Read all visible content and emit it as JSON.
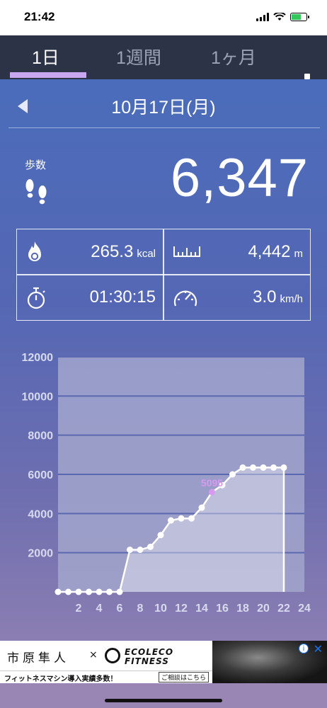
{
  "status_bar": {
    "time": "21:42"
  },
  "tabs": [
    {
      "label": "1日",
      "active": true
    },
    {
      "label": "1週間",
      "active": false
    },
    {
      "label": "1ヶ月",
      "active": false
    }
  ],
  "menu_icon": "kebab-menu-icon",
  "date": {
    "label": "10月17日(月)"
  },
  "steps": {
    "label": "歩数",
    "value": "6,347"
  },
  "stats": {
    "calories": {
      "value": "265.3",
      "unit": "kcal",
      "icon": "flame-icon"
    },
    "distance": {
      "value": "4,442",
      "unit": "m",
      "icon": "ruler-icon"
    },
    "duration": {
      "value": "01:30:15",
      "icon": "stopwatch-icon"
    },
    "speed": {
      "value": "3.0",
      "unit": "km/h",
      "icon": "speedometer-icon"
    }
  },
  "chart_data": {
    "type": "line",
    "x": [
      0,
      1,
      2,
      3,
      4,
      5,
      6,
      7,
      8,
      9,
      10,
      11,
      12,
      13,
      14,
      15,
      16,
      17,
      18,
      19,
      20,
      21,
      22
    ],
    "values": [
      0,
      0,
      0,
      0,
      0,
      0,
      0,
      2150,
      2150,
      2300,
      2900,
      3650,
      3750,
      3750,
      4300,
      5095,
      5450,
      6000,
      6347,
      6347,
      6347,
      6347,
      6347
    ],
    "highlight": {
      "x": 15,
      "label": "5095"
    },
    "xticks": [
      "2",
      "4",
      "6",
      "8",
      "10",
      "12",
      "14",
      "16",
      "18",
      "20",
      "22",
      "24"
    ],
    "yticks": [
      "2000",
      "4000",
      "6000",
      "8000",
      "10000",
      "12000"
    ],
    "xlim": [
      0,
      24
    ],
    "ylim": [
      0,
      12000
    ],
    "grid": true,
    "colors": {
      "line": "#ffffff",
      "highlight": "#d89af0",
      "plot_bg": "#a2a6cc",
      "grid": "#5a68b0"
    }
  },
  "ad": {
    "name": "市原隼人",
    "cross": "×",
    "brand_line1": "ECOLECO",
    "brand_line2": "FITNESS",
    "tagline": "フィットネスマシン導入実績多数！",
    "cta": "ご相談はこちら",
    "info_icon": "ad-info-icon",
    "close_icon": "ad-close-icon",
    "close": "✕",
    "info": "i"
  }
}
